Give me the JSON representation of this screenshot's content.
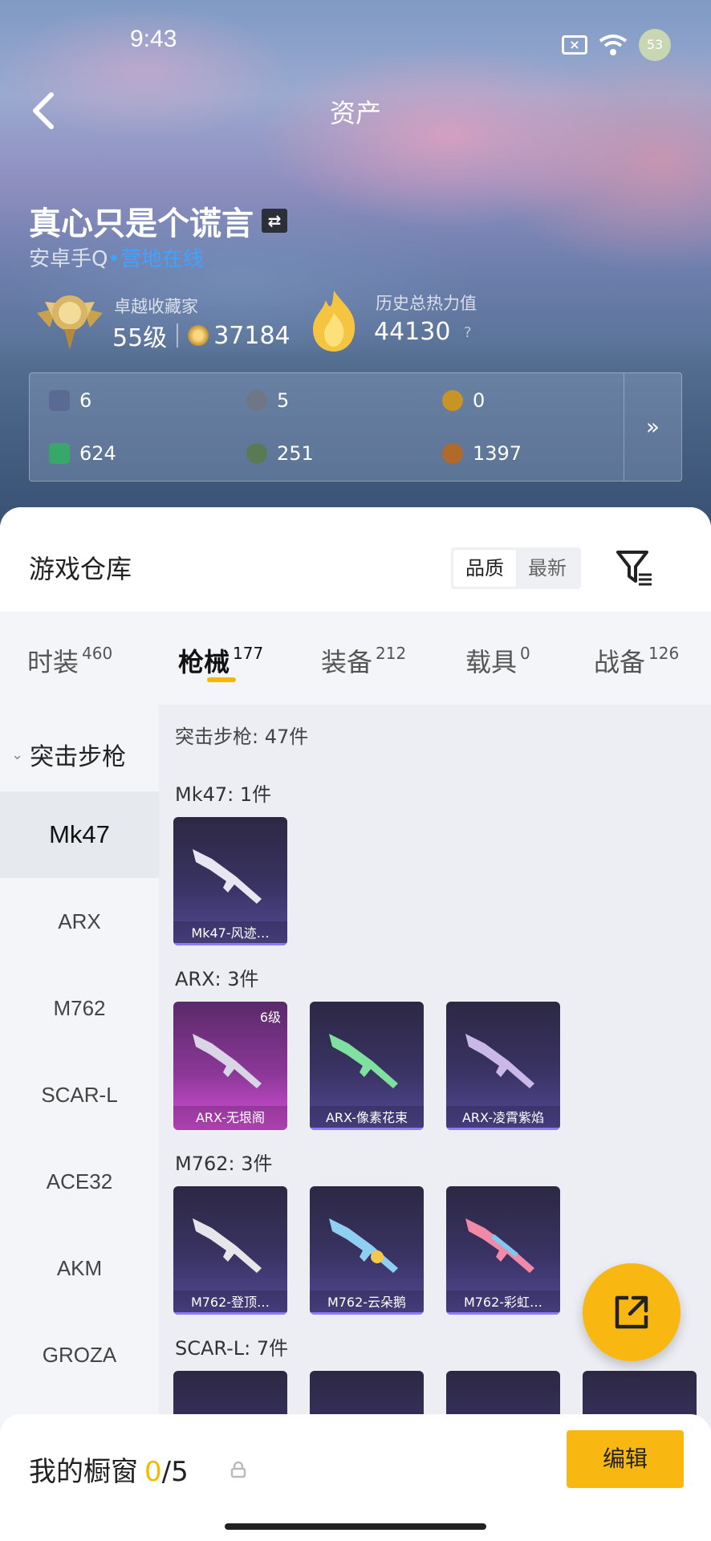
{
  "status": {
    "time": "9:43",
    "battery": "53"
  },
  "header": {
    "title": "资产"
  },
  "user": {
    "name": "真心只是个谎言",
    "platform": "安卓手Q",
    "presence": "营地在线"
  },
  "stats": {
    "collector_title": "卓越收藏家",
    "level": "55级",
    "points": "37184",
    "heat_title": "历史总热力值",
    "heat_value": "44130",
    "help": "?"
  },
  "resources": [
    {
      "icon": "card-icon",
      "value": "6",
      "color": "#5a6a92"
    },
    {
      "icon": "disc-icon",
      "value": "5",
      "color": "#6f7686"
    },
    {
      "icon": "gold-token-icon",
      "value": "0",
      "color": "#c99426"
    },
    {
      "icon": "green-card-icon",
      "value": "624",
      "color": "#37a86a"
    },
    {
      "icon": "orb-icon",
      "value": "251",
      "color": "#5a7a55"
    },
    {
      "icon": "bronze-coin-icon",
      "value": "1397",
      "color": "#b06a2a"
    }
  ],
  "warehouse": {
    "title": "游戏仓库",
    "sort_options": [
      "品质",
      "最新"
    ],
    "sort_active": "品质"
  },
  "categories": [
    {
      "label": "时装",
      "count": "460"
    },
    {
      "label": "枪械",
      "count": "177"
    },
    {
      "label": "装备",
      "count": "212"
    },
    {
      "label": "载具",
      "count": "0"
    },
    {
      "label": "战备",
      "count": "126"
    }
  ],
  "sidebar": {
    "group": "突击步枪",
    "items": [
      "Mk47",
      "ARX",
      "M762",
      "SCAR-L",
      "ACE32",
      "AKM",
      "GROZA"
    ],
    "active": "Mk47"
  },
  "content": {
    "summary": "突击步枪: 47件",
    "sections": [
      {
        "label": "Mk47: 1件",
        "items": [
          {
            "name": "Mk47-风迹…"
          }
        ]
      },
      {
        "label": "ARX: 3件",
        "items": [
          {
            "name": "ARX-无垠阁",
            "level": "6级"
          },
          {
            "name": "ARX-像素花束"
          },
          {
            "name": "ARX-凌霄紫焰"
          }
        ]
      },
      {
        "label": "M762: 3件",
        "items": [
          {
            "name": "M762-登顶…"
          },
          {
            "name": "M762-云朵鹅"
          },
          {
            "name": "M762-彩虹…"
          }
        ]
      },
      {
        "label": "SCAR-L: 7件"
      }
    ]
  },
  "showcase": {
    "label": "我的橱窗",
    "current": "0",
    "total": "/5",
    "edit": "编辑"
  },
  "colors": {
    "accent": "#f9b811",
    "online": "#3fa3ff"
  }
}
